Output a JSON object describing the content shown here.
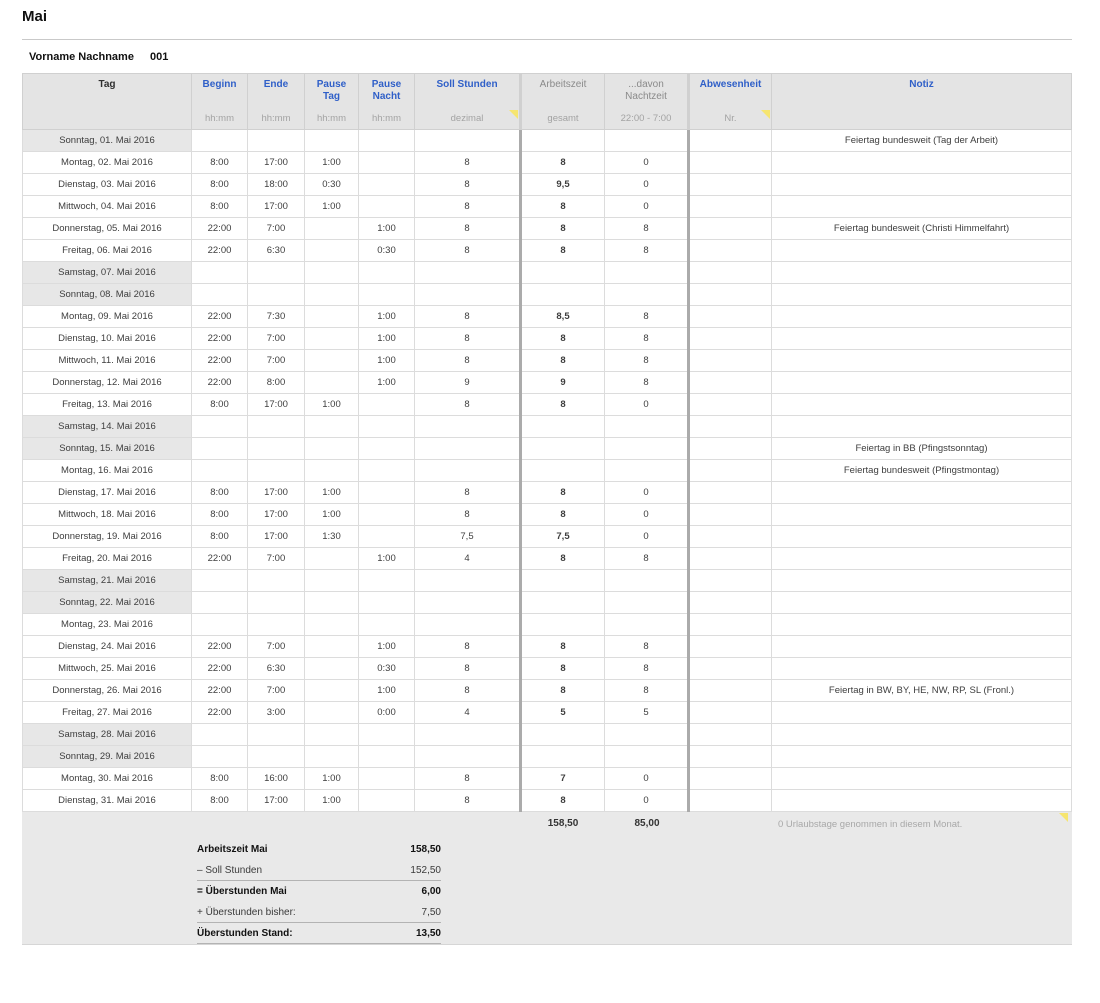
{
  "page": {
    "title": "Mai",
    "employee_name": "Vorname Nachname",
    "employee_id": "001"
  },
  "colors": {
    "accent-blue": "#2f5fc8",
    "comment-yellow": "#f6e570"
  },
  "table": {
    "columns": [
      {
        "key": "tag",
        "label": "Tag",
        "sublabel": "",
        "style": "dark",
        "group_start": false,
        "comment": false
      },
      {
        "key": "beginn",
        "label": "Beginn",
        "sublabel": "hh:mm",
        "style": "blue",
        "group_start": false,
        "comment": false
      },
      {
        "key": "ende",
        "label": "Ende",
        "sublabel": "hh:mm",
        "style": "blue",
        "group_start": false,
        "comment": false
      },
      {
        "key": "pause_tag",
        "label": "Pause Tag",
        "sublabel": "hh:mm",
        "style": "blue",
        "group_start": false,
        "comment": false
      },
      {
        "key": "pause_nacht",
        "label": "Pause Nacht",
        "sublabel": "hh:mm",
        "style": "blue",
        "group_start": false,
        "comment": false
      },
      {
        "key": "soll",
        "label": "Soll Stunden",
        "sublabel": "dezimal",
        "style": "blue",
        "group_start": false,
        "comment": true
      },
      {
        "key": "az",
        "label": "Arbeitszeit",
        "sublabel": "gesamt",
        "style": "gray",
        "group_start": true,
        "comment": false
      },
      {
        "key": "nz",
        "label": "...davon Nachtzeit",
        "sublabel": "22:00 - 7:00",
        "style": "gray",
        "group_start": false,
        "comment": false
      },
      {
        "key": "abw",
        "label": "Abwesenheit",
        "sublabel": "Nr.",
        "style": "blue",
        "group_start": true,
        "comment": true
      },
      {
        "key": "notiz",
        "label": "Notiz",
        "sublabel": "",
        "style": "blue",
        "group_start": false,
        "comment": false
      }
    ],
    "rows": [
      {
        "day": "Sonntag, 01. Mai 2016",
        "weekend": true,
        "beginn": "",
        "ende": "",
        "pause_tag": "",
        "pause_nacht": "",
        "soll": "",
        "az": "",
        "nz": "",
        "abwesenheit": "",
        "notiz": "Feiertag bundesweit (Tag der Arbeit)"
      },
      {
        "day": "Montag, 02. Mai 2016",
        "weekend": false,
        "beginn": "8:00",
        "ende": "17:00",
        "pause_tag": "1:00",
        "pause_nacht": "",
        "soll": "8",
        "az": "8",
        "nz": "0",
        "abwesenheit": "",
        "notiz": ""
      },
      {
        "day": "Dienstag, 03. Mai 2016",
        "weekend": false,
        "beginn": "8:00",
        "ende": "18:00",
        "pause_tag": "0:30",
        "pause_nacht": "",
        "soll": "8",
        "az": "9,5",
        "nz": "0",
        "abwesenheit": "",
        "notiz": ""
      },
      {
        "day": "Mittwoch, 04. Mai 2016",
        "weekend": false,
        "beginn": "8:00",
        "ende": "17:00",
        "pause_tag": "1:00",
        "pause_nacht": "",
        "soll": "8",
        "az": "8",
        "nz": "0",
        "abwesenheit": "",
        "notiz": ""
      },
      {
        "day": "Donnerstag, 05. Mai 2016",
        "weekend": false,
        "beginn": "22:00",
        "ende": "7:00",
        "pause_tag": "",
        "pause_nacht": "1:00",
        "soll": "8",
        "az": "8",
        "nz": "8",
        "abwesenheit": "",
        "notiz": "Feiertag bundesweit (Christi Himmelfahrt)"
      },
      {
        "day": "Freitag, 06. Mai 2016",
        "weekend": false,
        "beginn": "22:00",
        "ende": "6:30",
        "pause_tag": "",
        "pause_nacht": "0:30",
        "soll": "8",
        "az": "8",
        "nz": "8",
        "abwesenheit": "",
        "notiz": ""
      },
      {
        "day": "Samstag, 07. Mai 2016",
        "weekend": true,
        "beginn": "",
        "ende": "",
        "pause_tag": "",
        "pause_nacht": "",
        "soll": "",
        "az": "",
        "nz": "",
        "abwesenheit": "",
        "notiz": ""
      },
      {
        "day": "Sonntag, 08. Mai 2016",
        "weekend": true,
        "beginn": "",
        "ende": "",
        "pause_tag": "",
        "pause_nacht": "",
        "soll": "",
        "az": "",
        "nz": "",
        "abwesenheit": "",
        "notiz": ""
      },
      {
        "day": "Montag, 09. Mai 2016",
        "weekend": false,
        "beginn": "22:00",
        "ende": "7:30",
        "pause_tag": "",
        "pause_nacht": "1:00",
        "soll": "8",
        "az": "8,5",
        "nz": "8",
        "abwesenheit": "",
        "notiz": ""
      },
      {
        "day": "Dienstag, 10. Mai 2016",
        "weekend": false,
        "beginn": "22:00",
        "ende": "7:00",
        "pause_tag": "",
        "pause_nacht": "1:00",
        "soll": "8",
        "az": "8",
        "nz": "8",
        "abwesenheit": "",
        "notiz": ""
      },
      {
        "day": "Mittwoch, 11. Mai 2016",
        "weekend": false,
        "beginn": "22:00",
        "ende": "7:00",
        "pause_tag": "",
        "pause_nacht": "1:00",
        "soll": "8",
        "az": "8",
        "nz": "8",
        "abwesenheit": "",
        "notiz": ""
      },
      {
        "day": "Donnerstag, 12. Mai 2016",
        "weekend": false,
        "beginn": "22:00",
        "ende": "8:00",
        "pause_tag": "",
        "pause_nacht": "1:00",
        "soll": "9",
        "az": "9",
        "nz": "8",
        "abwesenheit": "",
        "notiz": ""
      },
      {
        "day": "Freitag, 13. Mai 2016",
        "weekend": false,
        "beginn": "8:00",
        "ende": "17:00",
        "pause_tag": "1:00",
        "pause_nacht": "",
        "soll": "8",
        "az": "8",
        "nz": "0",
        "abwesenheit": "",
        "notiz": ""
      },
      {
        "day": "Samstag, 14. Mai 2016",
        "weekend": true,
        "beginn": "",
        "ende": "",
        "pause_tag": "",
        "pause_nacht": "",
        "soll": "",
        "az": "",
        "nz": "",
        "abwesenheit": "",
        "notiz": ""
      },
      {
        "day": "Sonntag, 15. Mai 2016",
        "weekend": true,
        "beginn": "",
        "ende": "",
        "pause_tag": "",
        "pause_nacht": "",
        "soll": "",
        "az": "",
        "nz": "",
        "abwesenheit": "",
        "notiz": "Feiertag in BB (Pfingstsonntag)"
      },
      {
        "day": "Montag, 16. Mai 2016",
        "weekend": false,
        "beginn": "",
        "ende": "",
        "pause_tag": "",
        "pause_nacht": "",
        "soll": "",
        "az": "",
        "nz": "",
        "abwesenheit": "",
        "notiz": "Feiertag bundesweit (Pfingstmontag)"
      },
      {
        "day": "Dienstag, 17. Mai 2016",
        "weekend": false,
        "beginn": "8:00",
        "ende": "17:00",
        "pause_tag": "1:00",
        "pause_nacht": "",
        "soll": "8",
        "az": "8",
        "nz": "0",
        "abwesenheit": "",
        "notiz": ""
      },
      {
        "day": "Mittwoch, 18. Mai 2016",
        "weekend": false,
        "beginn": "8:00",
        "ende": "17:00",
        "pause_tag": "1:00",
        "pause_nacht": "",
        "soll": "8",
        "az": "8",
        "nz": "0",
        "abwesenheit": "",
        "notiz": ""
      },
      {
        "day": "Donnerstag, 19. Mai 2016",
        "weekend": false,
        "beginn": "8:00",
        "ende": "17:00",
        "pause_tag": "1:30",
        "pause_nacht": "",
        "soll": "7,5",
        "az": "7,5",
        "nz": "0",
        "abwesenheit": "",
        "notiz": ""
      },
      {
        "day": "Freitag, 20. Mai 2016",
        "weekend": false,
        "beginn": "22:00",
        "ende": "7:00",
        "pause_tag": "",
        "pause_nacht": "1:00",
        "soll": "4",
        "az": "8",
        "nz": "8",
        "abwesenheit": "",
        "notiz": ""
      },
      {
        "day": "Samstag, 21. Mai 2016",
        "weekend": true,
        "beginn": "",
        "ende": "",
        "pause_tag": "",
        "pause_nacht": "",
        "soll": "",
        "az": "",
        "nz": "",
        "abwesenheit": "",
        "notiz": ""
      },
      {
        "day": "Sonntag, 22. Mai 2016",
        "weekend": true,
        "beginn": "",
        "ende": "",
        "pause_tag": "",
        "pause_nacht": "",
        "soll": "",
        "az": "",
        "nz": "",
        "abwesenheit": "",
        "notiz": ""
      },
      {
        "day": "Montag, 23. Mai 2016",
        "weekend": false,
        "beginn": "",
        "ende": "",
        "pause_tag": "",
        "pause_nacht": "",
        "soll": "",
        "az": "",
        "nz": "",
        "abwesenheit": "",
        "notiz": ""
      },
      {
        "day": "Dienstag, 24. Mai 2016",
        "weekend": false,
        "beginn": "22:00",
        "ende": "7:00",
        "pause_tag": "",
        "pause_nacht": "1:00",
        "soll": "8",
        "az": "8",
        "nz": "8",
        "abwesenheit": "",
        "notiz": ""
      },
      {
        "day": "Mittwoch, 25. Mai 2016",
        "weekend": false,
        "beginn": "22:00",
        "ende": "6:30",
        "pause_tag": "",
        "pause_nacht": "0:30",
        "soll": "8",
        "az": "8",
        "nz": "8",
        "abwesenheit": "",
        "notiz": ""
      },
      {
        "day": "Donnerstag, 26. Mai 2016",
        "weekend": false,
        "beginn": "22:00",
        "ende": "7:00",
        "pause_tag": "",
        "pause_nacht": "1:00",
        "soll": "8",
        "az": "8",
        "nz": "8",
        "abwesenheit": "",
        "notiz": "Feiertag in BW, BY, HE, NW, RP, SL (Fronl.)"
      },
      {
        "day": "Freitag, 27. Mai 2016",
        "weekend": false,
        "beginn": "22:00",
        "ende": "3:00",
        "pause_tag": "",
        "pause_nacht": "0:00",
        "soll": "4",
        "az": "5",
        "nz": "5",
        "abwesenheit": "",
        "notiz": ""
      },
      {
        "day": "Samstag, 28. Mai 2016",
        "weekend": true,
        "beginn": "",
        "ende": "",
        "pause_tag": "",
        "pause_nacht": "",
        "soll": "",
        "az": "",
        "nz": "",
        "abwesenheit": "",
        "notiz": ""
      },
      {
        "day": "Sonntag, 29. Mai 2016",
        "weekend": true,
        "beginn": "",
        "ende": "",
        "pause_tag": "",
        "pause_nacht": "",
        "soll": "",
        "az": "",
        "nz": "",
        "abwesenheit": "",
        "notiz": ""
      },
      {
        "day": "Montag, 30. Mai 2016",
        "weekend": false,
        "beginn": "8:00",
        "ende": "16:00",
        "pause_tag": "1:00",
        "pause_nacht": "",
        "soll": "8",
        "az": "7",
        "nz": "0",
        "abwesenheit": "",
        "notiz": ""
      },
      {
        "day": "Dienstag, 31. Mai 2016",
        "weekend": false,
        "beginn": "8:00",
        "ende": "17:00",
        "pause_tag": "1:00",
        "pause_nacht": "",
        "soll": "8",
        "az": "8",
        "nz": "0",
        "abwesenheit": "",
        "notiz": ""
      }
    ]
  },
  "totals": {
    "arbeitszeit": "158,50",
    "nachtzeit": "85,00",
    "vacation_note": "0 Urlaubstage genommen in diesem Monat."
  },
  "summary": {
    "rows": [
      {
        "label": "Arbeitszeit Mai",
        "value": "158,50",
        "bold": true,
        "underline": false
      },
      {
        "label": "– Soll Stunden",
        "value": "152,50",
        "bold": false,
        "underline": true
      },
      {
        "label": "= Überstunden Mai",
        "value": "6,00",
        "bold": true,
        "underline": false
      },
      {
        "label": "+ Überstunden bisher:",
        "value": "7,50",
        "bold": false,
        "underline": true
      },
      {
        "label": "Überstunden Stand:",
        "value": "13,50",
        "bold": true,
        "underline": true
      }
    ]
  }
}
